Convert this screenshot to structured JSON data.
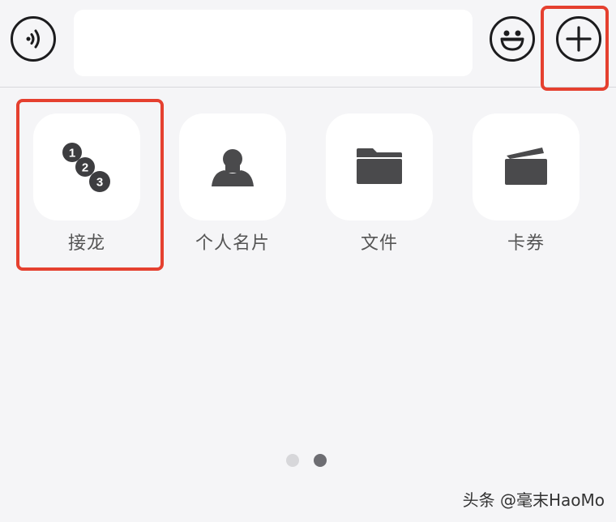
{
  "input_bar": {
    "voice_icon": "voice-wave-icon",
    "text_value": "",
    "emoji_icon": "smiley-icon",
    "plus_icon": "plus-icon"
  },
  "tools": [
    {
      "label": "接龙",
      "icon": "solitaire-123-icon",
      "numbers": [
        "1",
        "2",
        "3"
      ]
    },
    {
      "label": "个人名片",
      "icon": "person-card-icon"
    },
    {
      "label": "文件",
      "icon": "folder-icon"
    },
    {
      "label": "卡券",
      "icon": "wallet-card-icon"
    }
  ],
  "pager": {
    "total": 2,
    "active_index": 1
  },
  "watermark": "头条 @毫末HaoMo",
  "colors": {
    "background": "#f5f5f7",
    "tile": "#ffffff",
    "icon": "#4a4a4c",
    "highlight": "#e5402f"
  }
}
